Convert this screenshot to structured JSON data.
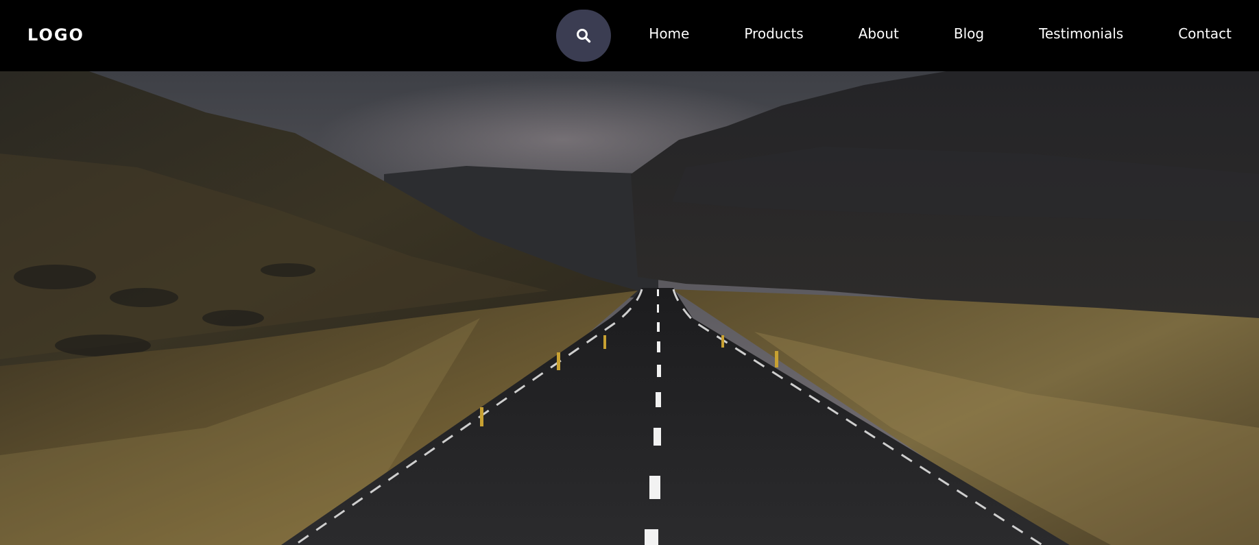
{
  "header": {
    "logo": "LOGO",
    "search_icon": "search-icon",
    "nav": [
      {
        "label": "Home"
      },
      {
        "label": "Products"
      },
      {
        "label": "About"
      },
      {
        "label": "Blog"
      },
      {
        "label": "Testimonials"
      },
      {
        "label": "Contact"
      }
    ]
  },
  "colors": {
    "header_bg": "#000000",
    "search_button_bg": "#3b3d52",
    "nav_text": "#ffffff"
  }
}
